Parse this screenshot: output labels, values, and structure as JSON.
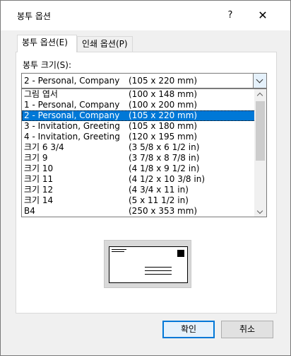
{
  "dialog": {
    "title": "봉투 옵션",
    "help_label": "?",
    "close_label": "✕"
  },
  "tabs": [
    {
      "label": "봉투 옵션(E)",
      "active": true
    },
    {
      "label": "인쇄 옵션(P)",
      "active": false
    }
  ],
  "envelope_size": {
    "label": "봉투 크기(S):",
    "selected_name": "2 - Personal, Company",
    "selected_dim": "(105 x 220 mm)",
    "options": [
      {
        "name": "그림 엽서",
        "dim": "(100 x 148 mm)"
      },
      {
        "name": "1 - Personal, Company",
        "dim": "(100 x 200 mm)"
      },
      {
        "name": "2 - Personal, Company",
        "dim": "(105 x 220 mm)",
        "selected": true
      },
      {
        "name": "3 - Invitation, Greeting",
        "dim": "(105 x 180 mm)"
      },
      {
        "name": "4 - Invitation, Greeting",
        "dim": "(120 x 195 mm)"
      },
      {
        "name": "크기 6 3/4",
        "dim": "(3 5/8 x 6 1/2 in)"
      },
      {
        "name": "크기 9",
        "dim": "(3 7/8 x 8 7/8 in)"
      },
      {
        "name": "크기 10",
        "dim": "(4 1/8 x 9 1/2 in)"
      },
      {
        "name": "크기 11",
        "dim": "(4 1/2 x 10 3/8 in)"
      },
      {
        "name": "크기 12",
        "dim": "(4 3/4 x 11 in)"
      },
      {
        "name": "크기 14",
        "dim": "(5 x 11 1/2 in)"
      },
      {
        "name": "B4",
        "dim": "(250 x 353 mm)"
      }
    ]
  },
  "buttons": {
    "ok": "확인",
    "cancel": "취소"
  },
  "colors": {
    "selection": "#0078d7"
  }
}
